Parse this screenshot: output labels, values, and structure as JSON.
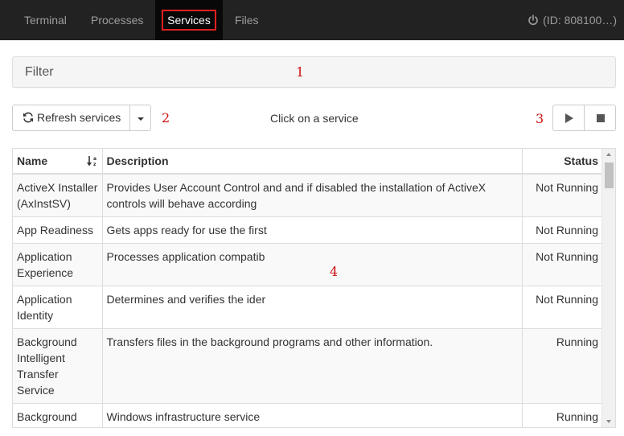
{
  "nav": {
    "tabs": [
      {
        "label": "Terminal"
      },
      {
        "label": "Processes"
      },
      {
        "label": "Services",
        "active": true
      },
      {
        "label": "Files"
      }
    ],
    "connection": "(ID: 808100…)",
    "connection_icon": "power-icon"
  },
  "filter": {
    "label": "Filter"
  },
  "toolbar": {
    "refresh_label": "Refresh services",
    "refresh_icon": "refresh-icon",
    "hint": "Click on a service",
    "play_icon": "play-icon",
    "stop_icon": "stop-icon"
  },
  "markers": [
    "1",
    "2",
    "3",
    "4"
  ],
  "table": {
    "columns": {
      "name": "Name",
      "description": "Description",
      "status": "Status"
    },
    "sort_icon": "sort-alpha-desc-icon",
    "rows": [
      {
        "name": "ActiveX Installer (AxInstSV)",
        "description": "Provides User Account Control and and if disabled the installation of ActiveX controls will behave according",
        "status": "Not Running"
      },
      {
        "name": "App Readiness",
        "description": "Gets apps ready for use the first",
        "status": "Not Running"
      },
      {
        "name": "Application Experience",
        "description": "Processes application compatib",
        "status": "Not Running"
      },
      {
        "name": "Application Identity",
        "description": "Determines and verifies the ider",
        "status": "Not Running"
      },
      {
        "name": "Background Intelligent Transfer Service",
        "description": "Transfers files in the background programs and other information.",
        "status": "Running"
      },
      {
        "name": "Background",
        "description": "Windows infrastructure service",
        "status": "Running"
      }
    ]
  },
  "colors": {
    "nav_bg": "#222222",
    "active_tab_outline": "#e02020",
    "marker": "#cc1111"
  }
}
